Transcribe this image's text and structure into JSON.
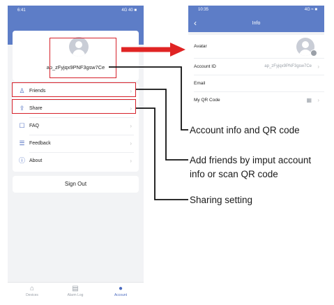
{
  "left_screen": {
    "status_time": "6:41",
    "status_icons": "4G 40 ■",
    "account_name": "ap_zFyjqx9PNF3gsw7Ce",
    "menu_items": [
      {
        "label": "Friends",
        "icon": "person-icon",
        "glyph": "♙"
      },
      {
        "label": "Share",
        "icon": "share-icon",
        "glyph": "⇪"
      },
      {
        "label": "FAQ",
        "icon": "faq-icon",
        "glyph": "☐"
      },
      {
        "label": "Feedback",
        "icon": "feedback-icon",
        "glyph": "☰"
      },
      {
        "label": "About",
        "icon": "info-icon",
        "glyph": "ⓘ"
      }
    ],
    "chevron": "›",
    "sign_out_label": "Sign Out",
    "tabs": [
      {
        "label": "Devices",
        "icon": "home-icon",
        "glyph": "⌂",
        "active": false
      },
      {
        "label": "Alarm Log",
        "icon": "log-icon",
        "glyph": "▤",
        "active": false
      },
      {
        "label": "Account",
        "icon": "person-icon",
        "glyph": "●",
        "active": true
      }
    ]
  },
  "right_screen": {
    "status_time": "10:35",
    "status_icons": "4G ≈ ■",
    "back_glyph": "‹",
    "title": "Info",
    "rows": [
      {
        "label": "Avatar",
        "value": ""
      },
      {
        "label": "Account ID",
        "value": "ap_zFyjqx9PNF3gsw7Ce"
      },
      {
        "label": "Email",
        "value": ""
      },
      {
        "label": "My QR Code",
        "value": "▦"
      }
    ]
  },
  "annotations": {
    "account_info": "Account info and QR code",
    "add_friends_line1": "Add friends by imput account",
    "add_friends_line2": "info or scan QR code",
    "sharing": "Sharing setting"
  },
  "colors": {
    "brand_blue": "#5d7dc7",
    "highlight_red": "#d6202a",
    "arrow_red": "#e02424"
  }
}
